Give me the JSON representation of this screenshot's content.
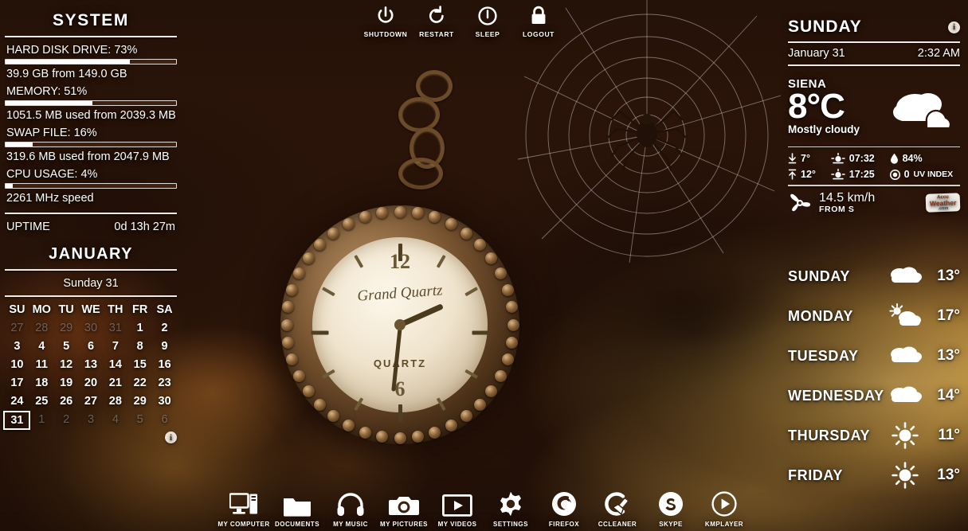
{
  "system": {
    "title": "SYSTEM",
    "metrics": [
      {
        "label": "HARD DISK DRIVE: 73%",
        "percent": 73,
        "sub": "39.9 GB from 149.0 GB"
      },
      {
        "label": "MEMORY: 51%",
        "percent": 51,
        "sub": "1051.5 MB used from 2039.3 MB"
      },
      {
        "label": "SWAP FILE: 16%",
        "percent": 16,
        "sub": "319.6 MB used from 2047.9 MB"
      },
      {
        "label": "CPU USAGE: 4%",
        "percent": 4,
        "sub": "2261 MHz speed"
      }
    ],
    "uptime_label": "UPTIME",
    "uptime_value": "0d 13h 27m"
  },
  "calendar": {
    "month": "JANUARY",
    "subtitle": "Sunday 31",
    "weekdays": [
      "SU",
      "MO",
      "TU",
      "WE",
      "TH",
      "FR",
      "SA"
    ],
    "weeks": [
      [
        {
          "d": "27",
          "dim": true
        },
        {
          "d": "28",
          "dim": true
        },
        {
          "d": "29",
          "dim": true
        },
        {
          "d": "30",
          "dim": true
        },
        {
          "d": "31",
          "dim": true
        },
        {
          "d": "1",
          "dim": false
        },
        {
          "d": "2",
          "dim": false
        }
      ],
      [
        {
          "d": "3",
          "dim": false
        },
        {
          "d": "4",
          "dim": false
        },
        {
          "d": "5",
          "dim": false
        },
        {
          "d": "6",
          "dim": false
        },
        {
          "d": "7",
          "dim": false
        },
        {
          "d": "8",
          "dim": false
        },
        {
          "d": "9",
          "dim": false
        }
      ],
      [
        {
          "d": "10",
          "dim": false
        },
        {
          "d": "11",
          "dim": false
        },
        {
          "d": "12",
          "dim": false
        },
        {
          "d": "13",
          "dim": false
        },
        {
          "d": "14",
          "dim": false
        },
        {
          "d": "15",
          "dim": false
        },
        {
          "d": "16",
          "dim": false
        }
      ],
      [
        {
          "d": "17",
          "dim": false
        },
        {
          "d": "18",
          "dim": false
        },
        {
          "d": "19",
          "dim": false
        },
        {
          "d": "20",
          "dim": false
        },
        {
          "d": "21",
          "dim": false
        },
        {
          "d": "22",
          "dim": false
        },
        {
          "d": "23",
          "dim": false
        }
      ],
      [
        {
          "d": "24",
          "dim": false
        },
        {
          "d": "25",
          "dim": false
        },
        {
          "d": "26",
          "dim": false
        },
        {
          "d": "27",
          "dim": false
        },
        {
          "d": "28",
          "dim": false
        },
        {
          "d": "29",
          "dim": false
        },
        {
          "d": "30",
          "dim": false
        }
      ],
      [
        {
          "d": "31",
          "dim": false,
          "today": true
        },
        {
          "d": "1",
          "dim": true
        },
        {
          "d": "2",
          "dim": true
        },
        {
          "d": "3",
          "dim": true
        },
        {
          "d": "4",
          "dim": true
        },
        {
          "d": "5",
          "dim": true
        },
        {
          "d": "6",
          "dim": true
        }
      ]
    ],
    "info_icon": "info-icon",
    "info_glyph": "i"
  },
  "power_menu": [
    {
      "label": "SHUTDOWN",
      "icon": "power-icon"
    },
    {
      "label": "RESTART",
      "icon": "restart-icon"
    },
    {
      "label": "SLEEP",
      "icon": "sleep-icon"
    },
    {
      "label": "LOGOUT",
      "icon": "lock-icon"
    }
  ],
  "weather": {
    "day": "SUNDAY",
    "date": "January 31",
    "time": "2:32 AM",
    "info_icon": "info-icon",
    "info_glyph": "i",
    "city": "SIENA",
    "temperature": "8°C",
    "condition": "Mostly cloudy",
    "condition_icon": "cloudy-icon",
    "details": {
      "low": "7°",
      "high": "12°",
      "sunrise": "07:32",
      "sunset": "17:25",
      "humidity": "84%",
      "uv_value": "0",
      "uv_label": "UV INDEX"
    },
    "wind_speed": "14.5 km/h",
    "wind_direction": "FROM S",
    "wind_icon": "wind-propeller-icon",
    "provider": {
      "line1": "Accu",
      "line2": "Weather",
      "line3": ".com"
    }
  },
  "forecast": [
    {
      "name": "SUNDAY",
      "icon": "cloudy-icon",
      "temp": "13°"
    },
    {
      "name": "MONDAY",
      "icon": "partly-sunny-icon",
      "temp": "17°"
    },
    {
      "name": "TUESDAY",
      "icon": "cloudy-icon",
      "temp": "13°"
    },
    {
      "name": "WEDNESDAY",
      "icon": "cloudy-icon",
      "temp": "14°"
    },
    {
      "name": "THURSDAY",
      "icon": "sunny-icon",
      "temp": "11°"
    },
    {
      "name": "FRIDAY",
      "icon": "sunny-icon",
      "temp": "13°"
    }
  ],
  "dock": [
    {
      "label": "MY COMPUTER",
      "icon": "computer-icon"
    },
    {
      "label": "DOCUMENTS",
      "icon": "folder-icon"
    },
    {
      "label": "MY MUSIC",
      "icon": "headphones-icon"
    },
    {
      "label": "MY PICTURES",
      "icon": "camera-icon"
    },
    {
      "label": "MY VIDEOS",
      "icon": "video-icon"
    },
    {
      "label": "SETTINGS",
      "icon": "gear-icon"
    },
    {
      "label": "FIREFOX",
      "icon": "firefox-icon"
    },
    {
      "label": "CCLEANER",
      "icon": "ccleaner-icon"
    },
    {
      "label": "SKYPE",
      "icon": "skype-icon"
    },
    {
      "label": "KMPLAYER",
      "icon": "play-circle-icon"
    }
  ],
  "watch": {
    "numeral_top": "12",
    "numeral_bottom": "6",
    "brand": "Grand Quartz",
    "label": "QUARTZ"
  }
}
